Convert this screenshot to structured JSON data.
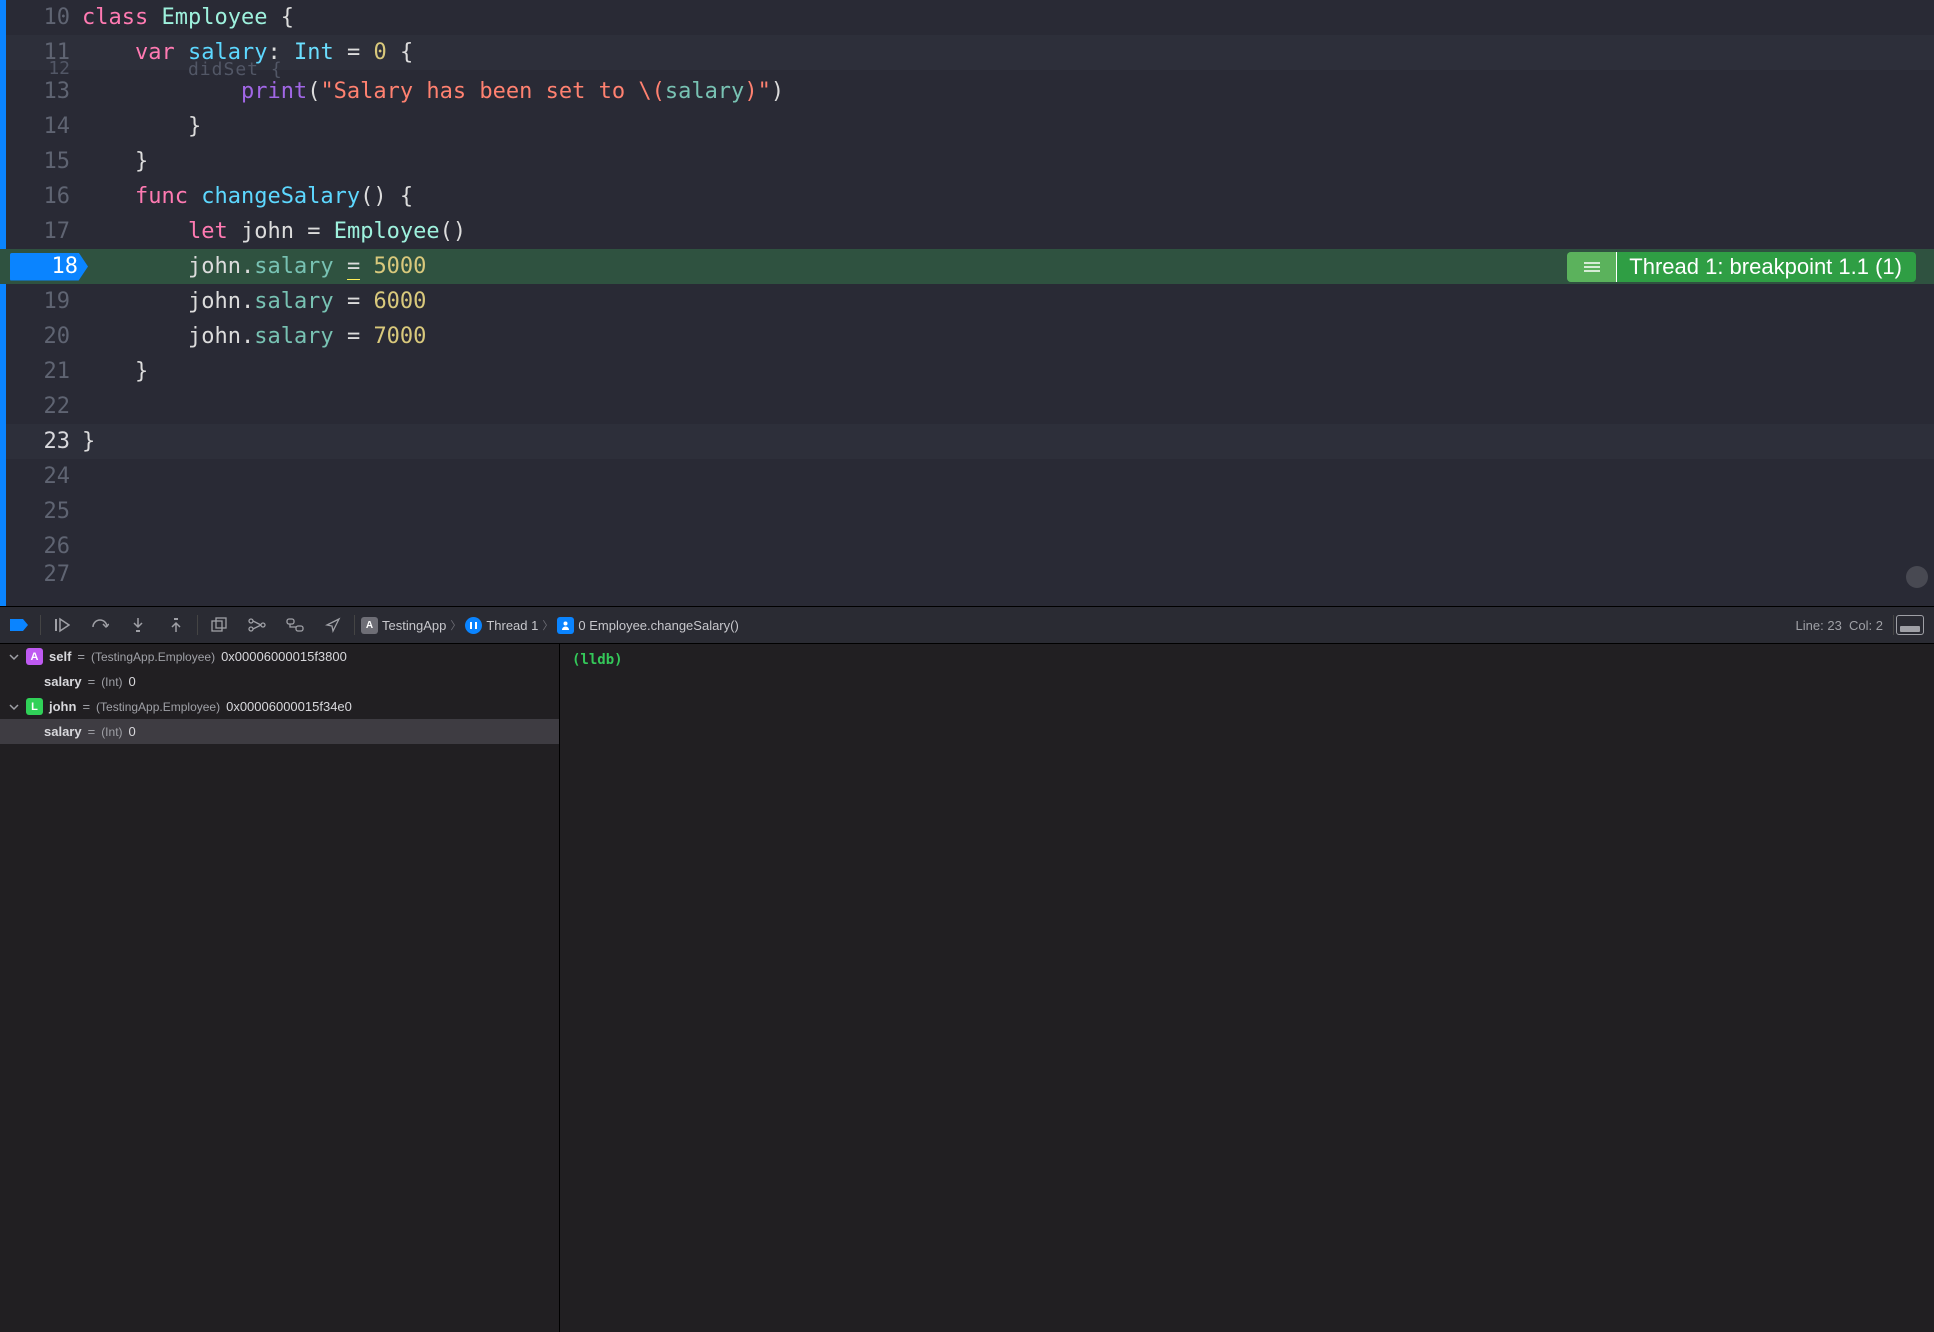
{
  "editor": {
    "lines": [
      {
        "n": 10
      },
      {
        "n": 11
      },
      {
        "n": 12
      },
      {
        "n": 13
      },
      {
        "n": 14
      },
      {
        "n": 15
      },
      {
        "n": 16
      },
      {
        "n": 17
      },
      {
        "n": 18
      },
      {
        "n": 19
      },
      {
        "n": 20
      },
      {
        "n": 21
      },
      {
        "n": 22
      },
      {
        "n": 23
      },
      {
        "n": 24
      },
      {
        "n": 25
      },
      {
        "n": 26
      },
      {
        "n": 27
      }
    ],
    "code": {
      "l10_class": "class",
      "l10_name": "Employee",
      "l10_brace": " {",
      "l11_var": "var",
      "l11_name": "salary",
      "l11_colon": ":",
      "l11_type": "Int",
      "l11_eq": "=",
      "l11_zero": "0",
      "l11_brace": "{",
      "l12_dim": "didSet {",
      "l13_print": "print",
      "l13_open": "(",
      "l13_str1": "\"Salary has been set to ",
      "l13_interp_open": "\\(",
      "l13_interp_var": "salary",
      "l13_interp_close": ")",
      "l13_str2": "\"",
      "l13_close": ")",
      "l14_brace": "}",
      "l15_brace": "}",
      "l16_func": "func",
      "l16_name": "changeSalary",
      "l16_paren": "()",
      "l16_brace": " {",
      "l17_let": "let",
      "l17_var": "john",
      "l17_eq": "=",
      "l17_type": "Employee",
      "l17_paren": "()",
      "l18_obj": "john",
      "l18_dot": ".",
      "l18_prop": "salary",
      "l18_eq": "=",
      "l18_val": "5000",
      "l19_obj": "john",
      "l19_dot": ".",
      "l19_prop": "salary",
      "l19_eq": "=",
      "l19_val": "6000",
      "l20_obj": "john",
      "l20_dot": ".",
      "l20_prop": "salary",
      "l20_eq": "=",
      "l20_val": "7000",
      "l21_brace": "}",
      "l23_brace": "}"
    },
    "breakpoint_line": "18",
    "annotation": "Thread 1: breakpoint 1.1 (1)"
  },
  "toolbar": {
    "crumbs": {
      "app": "TestingApp",
      "thread": "Thread 1",
      "frame": "0 Employee.changeSalary()"
    },
    "status_line": "Line: 23",
    "status_col": "Col: 2"
  },
  "vars": {
    "self_name": "self",
    "self_type": "(TestingApp.Employee)",
    "self_val": "0x00006000015f3800",
    "self_salary_name": "salary",
    "self_salary_type": "(Int)",
    "self_salary_val": "0",
    "john_name": "john",
    "john_type": "(TestingApp.Employee)",
    "john_val": "0x00006000015f34e0",
    "john_salary_name": "salary",
    "john_salary_type": "(Int)",
    "john_salary_val": "0"
  },
  "console": {
    "prompt": "(lldb)"
  }
}
